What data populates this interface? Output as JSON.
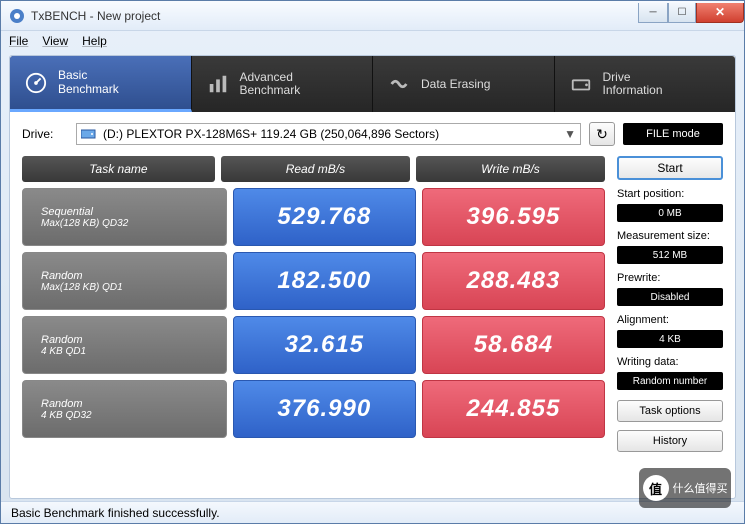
{
  "window": {
    "title": "TxBENCH - New project"
  },
  "menu": {
    "file": "File",
    "view": "View",
    "help": "Help"
  },
  "tabs": {
    "basic": "Basic\nBenchmark",
    "advanced": "Advanced\nBenchmark",
    "erase": "Data Erasing",
    "drive": "Drive\nInformation"
  },
  "drive": {
    "label": "Drive:",
    "value": "(D:) PLEXTOR PX-128M6S+  119.24 GB (250,064,896 Sectors)",
    "filemode": "FILE mode"
  },
  "headers": {
    "task": "Task name",
    "read": "Read mB/s",
    "write": "Write mB/s"
  },
  "rows": [
    {
      "name": "Sequential",
      "sub": "Max(128 KB) QD32",
      "read": "529.768",
      "write": "396.595"
    },
    {
      "name": "Random",
      "sub": "Max(128 KB) QD1",
      "read": "182.500",
      "write": "288.483"
    },
    {
      "name": "Random",
      "sub": "4 KB QD1",
      "read": "32.615",
      "write": "58.684"
    },
    {
      "name": "Random",
      "sub": "4 KB QD32",
      "read": "376.990",
      "write": "244.855"
    }
  ],
  "side": {
    "start": "Start",
    "startpos_label": "Start position:",
    "startpos": "0 MB",
    "meas_label": "Measurement size:",
    "meas": "512 MB",
    "prewrite_label": "Prewrite:",
    "prewrite": "Disabled",
    "align_label": "Alignment:",
    "align": "4 KB",
    "writedata_label": "Writing data:",
    "writedata": "Random number",
    "taskopts": "Task options",
    "history": "History"
  },
  "status": "Basic Benchmark finished successfully.",
  "watermark": "什么值得买"
}
